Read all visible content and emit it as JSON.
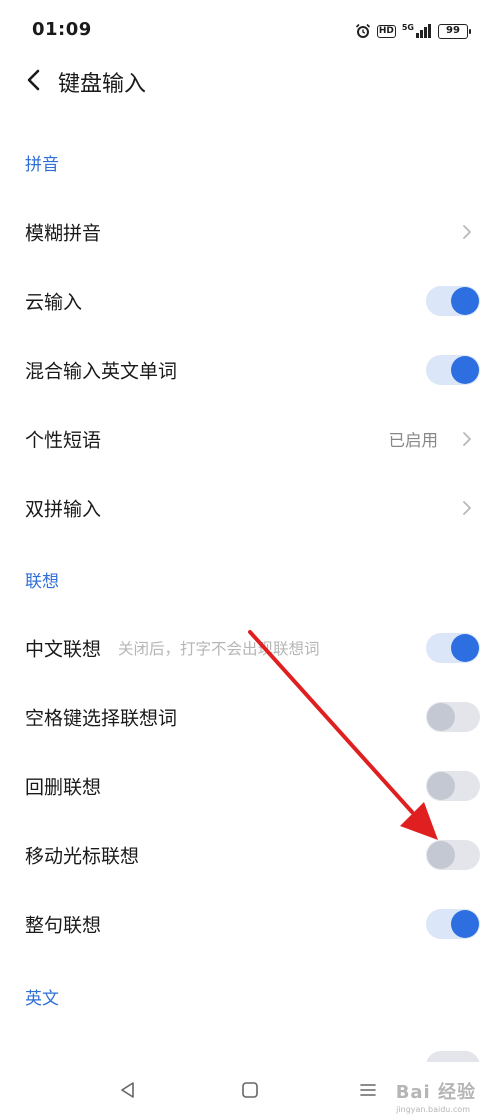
{
  "status_bar": {
    "time": "01:09",
    "signal_text": "5G",
    "hd_badge": "HD",
    "battery": "99"
  },
  "header": {
    "title": "键盘输入",
    "back_icon": "chevron-left-icon"
  },
  "sections": {
    "pinyin": {
      "title": "拼音",
      "items": [
        {
          "label": "模糊拼音",
          "control": "chevron"
        },
        {
          "label": "云输入",
          "control": "toggle",
          "on": true
        },
        {
          "label": "混合输入英文单词",
          "control": "toggle",
          "on": true
        },
        {
          "label": "个性短语",
          "value": "已启用",
          "control": "chevron"
        },
        {
          "label": "双拼输入",
          "control": "chevron"
        }
      ]
    },
    "association": {
      "title": "联想",
      "items": [
        {
          "label": "中文联想",
          "hint": "关闭后，打字不会出现联想词",
          "control": "toggle",
          "on": true
        },
        {
          "label": "空格键选择联想词",
          "control": "toggle",
          "on": false
        },
        {
          "label": "回删联想",
          "control": "toggle",
          "on": false
        },
        {
          "label": "移动光标联想",
          "control": "toggle",
          "on": false
        },
        {
          "label": "整句联想",
          "control": "toggle",
          "on": true
        }
      ]
    },
    "english": {
      "title": "英文"
    }
  },
  "nav_bar": {
    "back_icon": "triangle-back-icon",
    "home_icon": "square-home-icon",
    "menu_icon": "menu-lines-icon"
  },
  "watermark": {
    "text": "Bai 经验",
    "sub": "jingyan.baidu.com"
  },
  "colors": {
    "accent": "#2d6fe0",
    "section_header": "#2f6fd6",
    "toggle_on_track": "#dbe6f8",
    "toggle_off_track": "#e3e5ea",
    "annotation_arrow": "#e02020"
  }
}
